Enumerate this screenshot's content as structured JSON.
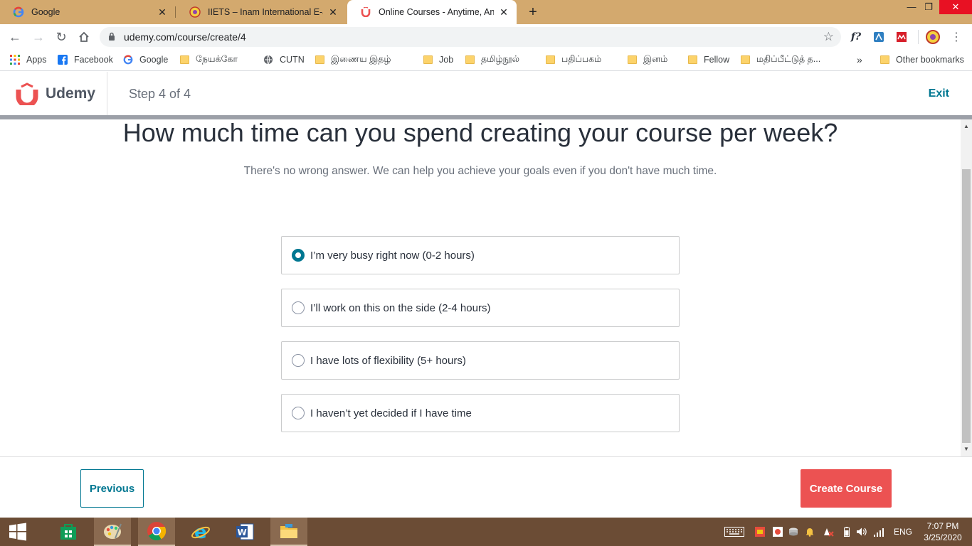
{
  "browser": {
    "tabs": [
      {
        "title": "Google",
        "icon": "google-icon",
        "active": false
      },
      {
        "title": "IIETS – Inam International E-Journ",
        "icon": "iiets-icon",
        "active": false
      },
      {
        "title": "Online Courses - Anytime, Anywh",
        "icon": "udemy-icon",
        "active": true
      }
    ],
    "url": "udemy.com/course/create/4",
    "bookmarks": [
      {
        "label": "Apps",
        "icon": "apps-grid-icon"
      },
      {
        "label": "Facebook",
        "icon": "facebook-icon"
      },
      {
        "label": "Google",
        "icon": "google-icon"
      },
      {
        "label": "நேயக்கோ",
        "icon": "folder-icon"
      },
      {
        "label": "CUTN",
        "icon": "globe-icon"
      },
      {
        "label": "இணைய இதழ்",
        "icon": "folder-icon"
      },
      {
        "label": "Job",
        "icon": "folder-icon"
      },
      {
        "label": "தமிழ்நூல்",
        "icon": "folder-icon"
      },
      {
        "label": "பதிப்பகம்",
        "icon": "folder-icon"
      },
      {
        "label": "இனம்",
        "icon": "folder-icon"
      },
      {
        "label": "Fellow",
        "icon": "folder-icon"
      },
      {
        "label": "மதிப்பீட்டுத் த...",
        "icon": "folder-icon"
      }
    ],
    "more_bookmarks": "»",
    "other_bookmarks": "Other bookmarks"
  },
  "header": {
    "brand": "Udemy",
    "step": "Step 4 of 4",
    "exit": "Exit",
    "brand_color": "#ec5252",
    "link_color": "#007791"
  },
  "main": {
    "question": "How much time can you spend creating your course per week?",
    "subtitle": "There's no wrong answer. We can help you achieve your goals even if you don't have much time.",
    "options": [
      {
        "label": "I’m very busy right now (0-2 hours)",
        "selected": true
      },
      {
        "label": "I’ll work on this on the side (2-4 hours)",
        "selected": false
      },
      {
        "label": "I have lots of flexibility (5+ hours)",
        "selected": false
      },
      {
        "label": "I haven’t yet decided if I have time",
        "selected": false
      }
    ]
  },
  "footer": {
    "previous": "Previous",
    "create": "Create Course"
  },
  "taskbar": {
    "language": "ENG",
    "time": "7:07 PM",
    "date": "3/25/2020"
  }
}
